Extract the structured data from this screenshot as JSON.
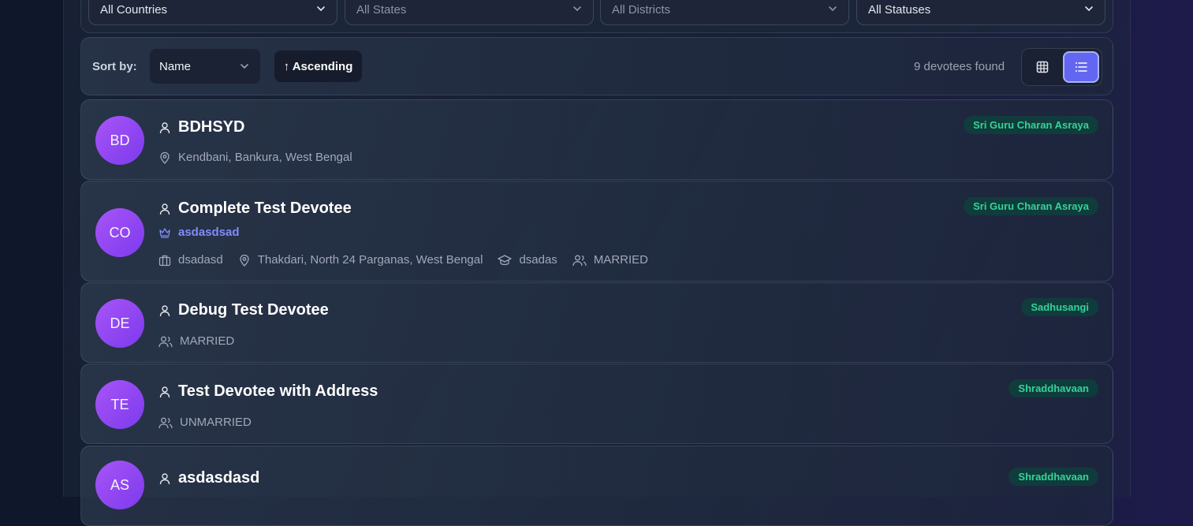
{
  "filters": {
    "country": "All Countries",
    "state": "All States",
    "district": "All Districts",
    "status": "All Statuses"
  },
  "sort": {
    "label": "Sort by:",
    "field": "Name",
    "order": "↑ Ascending"
  },
  "results": {
    "count_text": "9 devotees found"
  },
  "view": {
    "active": "list"
  },
  "devotees": [
    {
      "initials": "BD",
      "name": "BDHSYD",
      "badge": "Sri Guru Charan Asraya",
      "location": "Kendbani, Bankura, West Bengal"
    },
    {
      "initials": "CO",
      "name": "Complete Test Devotee",
      "badge": "Sri Guru Charan Asraya",
      "guru": "asdasdsad",
      "occupation": "dsadasd",
      "location": "Thakdari, North 24 Parganas, West Bengal",
      "education": "dsadas",
      "marital": "MARRIED"
    },
    {
      "initials": "DE",
      "name": "Debug Test Devotee",
      "badge": "Sadhusangi",
      "marital": "MARRIED"
    },
    {
      "initials": "TE",
      "name": "Test Devotee with Address",
      "badge": "Shraddhavaan",
      "marital": "UNMARRIED"
    },
    {
      "initials": "AS",
      "name": "asdasdasd",
      "badge": "Shraddhavaan"
    }
  ],
  "icons": {
    "chevron": "chevron-down-icon",
    "grid": "grid-icon",
    "list": "list-icon",
    "user": "user-icon",
    "pin": "map-pin-icon",
    "crown": "crown-icon",
    "briefcase": "briefcase-icon",
    "cap": "graduation-cap-icon",
    "users": "users-icon"
  },
  "colors": {
    "accent": "#6366f1",
    "badge_text": "#34d399",
    "guru_link": "#818cf8",
    "avatar": "#a855f7"
  }
}
